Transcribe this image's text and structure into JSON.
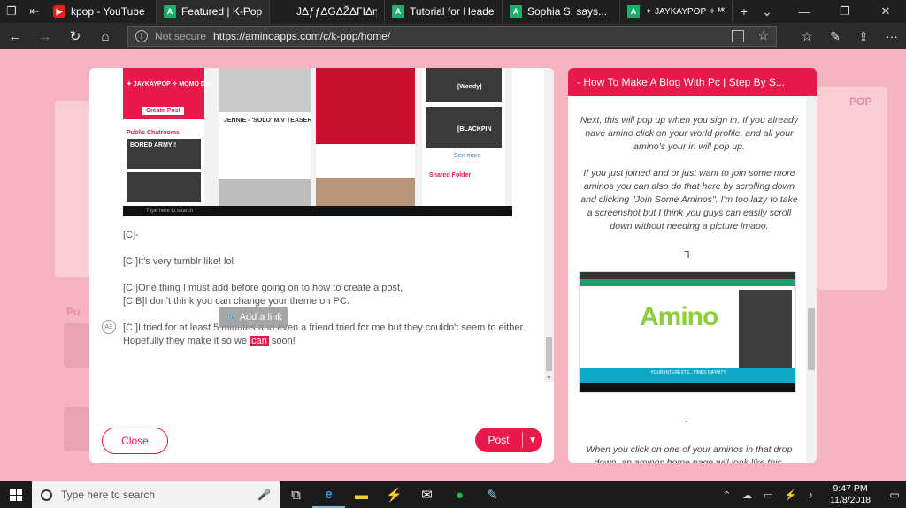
{
  "browser": {
    "tabs": [
      {
        "title": "kpop - YouTube",
        "favicon": "youtube-icon",
        "active": false
      },
      {
        "title": "Featured | K-Pop Ai",
        "favicon": "amino-icon",
        "active": true
      },
      {
        "title": "JΔƒƒΔGΔŽΔΓIΔη • Cool",
        "favicon": "",
        "active": false
      },
      {
        "title": "Tutorial for Headers, Bc",
        "favicon": "amino-icon",
        "active": false
      },
      {
        "title": "Sophia S. says...",
        "favicon": "amino-icon",
        "active": false
      },
      {
        "title": "✦ JAYKAYPOP ✧ ᴹᴼᴹᴼ ᴰᴬʸ |",
        "favicon": "amino-icon",
        "active": false
      }
    ],
    "address": {
      "security": "Not secure",
      "url": "https://aminoapps.com/c/k-pop/home/"
    }
  },
  "editor": {
    "lines": [
      "[C]-",
      "[CI]It's very tumblr like! lol",
      "[CI]One thing I must add before going on to how to create a post,",
      "[CIB]I don't think you can change your theme on PC.",
      "[CI]I tried for at least 5 minutes and even a friend tried for me but they couldn't seem to either.",
      "Hopefully they make it so we ",
      "can",
      " soon!"
    ],
    "tooltip": "Add a link",
    "tooltip_icon": "link-icon",
    "badge": "AΞ",
    "close_label": "Close",
    "post_label": "Post",
    "screenshot": {
      "profile_name": "✦ JAYKAYPOP ✧ MOMO DAy",
      "create_post": "Create Post",
      "chatrooms_label": "Public Chatrooms",
      "chat1": "BORED ARMY!!",
      "video_title": "JENNIE - 'SOLO' M/V TEASER",
      "search_placeholder": "Type here to search",
      "wendy": "[Wendy]",
      "blackpink": "[BLACKPIN",
      "see_more": "See more",
      "shared_folder": "Shared Folder"
    }
  },
  "preview": {
    "title": "- How To Make A Blog With Pc | Step By S...",
    "para1": "Next, this will pop up when you sign in. If you already have amino click on your world profile, and all your amino's your in will pop up.",
    "para2": "If you just joined and or just want to join some more aminos you can also do that here by scrolling down and clicking \"Join Some Aminos\". I'm too lazy to take a screenshot but I think you guys can easily scroll down without needing a picture lmaoo.",
    "glyph": "ᒣ",
    "dash": "-",
    "para3": "When you click on one of your aminos in that drop down, an aminos home page will look like this.",
    "screenshot": {
      "logo_word": "Amino",
      "tagline": "YOUR INTERESTS...TIMES INFINITY"
    }
  },
  "taskbar": {
    "search_placeholder": "Type here to search",
    "time": "9:47 PM",
    "date": "11/8/2018",
    "apps": [
      "task-view-icon",
      "edge-icon",
      "file-explorer-icon",
      "bolt-app-icon",
      "mail-icon",
      "spotify-icon",
      "paint-icon"
    ]
  },
  "colors": {
    "accent": "#e8194b",
    "page_bg": "#f6b3c2",
    "chrome_dark": "#1f1f1f"
  }
}
